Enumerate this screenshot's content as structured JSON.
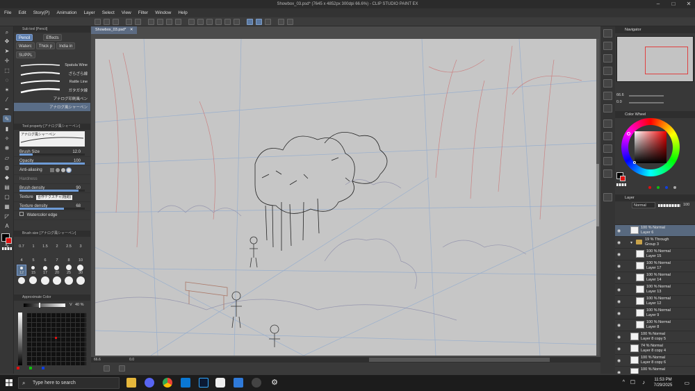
{
  "window": {
    "title": "Showbox_03.psd* (7645 x 4852px 300dpi 66.6%) - CLIP STUDIO PAINT EX"
  },
  "menu": [
    "File",
    "Edit",
    "Story(P)",
    "Animation",
    "Layer",
    "Select",
    "View",
    "Filter",
    "Window",
    "Help"
  ],
  "subtool": {
    "header": "Sub tool [Pencil]",
    "tabs": [
      "Pencil",
      "Effects",
      "Waterc",
      "Thick p",
      "India in",
      "SUPPL"
    ],
    "active_tab": "Pencil",
    "brushes": [
      "Spatula Wine",
      "ざらざら線",
      "Rattle Line",
      "ガタガタ線",
      "アナログ印刷風ペン",
      "アナログ風シャーペン"
    ],
    "active_brush": "アナログ風シャーペン"
  },
  "tool_property": {
    "header": "Tool property [アナログ風シャーペン]",
    "preview_label": "アナログ風シャーペン",
    "brush_size_label": "Brush Size",
    "brush_size": "12.0",
    "brush_size_fraction": 0.2,
    "opacity_label": "Opacity",
    "opacity": "100",
    "opacity_fraction": 1.0,
    "antialias_label": "Anti-aliasing",
    "hardness_label": "Hardness",
    "brush_density_label": "Brush density",
    "brush_density": "90",
    "brush_density_fraction": 0.9,
    "texture_label": "Texture",
    "texture_value": "合作テクスチャ(粗紙)",
    "texture_density_label": "Texture density",
    "texture_density": "68",
    "texture_density_fraction": 0.68,
    "watercolor_edge_label": "Watercolor edge"
  },
  "brush_size_panel": {
    "header": "Brush size [アナログ風シャーペン]",
    "row1": [
      "0.7",
      "1",
      "1.5",
      "2",
      "2.5",
      "3"
    ],
    "row2": [
      "4",
      "5",
      "6",
      "7",
      "8",
      "10"
    ],
    "row3": [
      "12",
      "15",
      "17",
      "20",
      "25",
      "30"
    ],
    "row4": [
      "40",
      "50",
      "60",
      "70",
      "80",
      "100"
    ],
    "selected": "12"
  },
  "approx_color": {
    "header": "Approximate Color",
    "v_label": "V",
    "v_value": "40 %",
    "v_fraction": 0.4
  },
  "canvas": {
    "tab_label": "Showbox_03.psd*",
    "zoom": "66.6",
    "status_coords": "0.0"
  },
  "navigator": {
    "header": "Navigator",
    "zoom": "66.6",
    "angle": "0.0"
  },
  "color_wheel": {
    "header": "Color Wheel",
    "main_color": "#000000",
    "sub_color": "#e01010"
  },
  "layer_panel": {
    "header": "Layer",
    "blend_mode": "Normal",
    "opacity": "100",
    "layers": [
      {
        "line1": "100 % Normal",
        "line2": "Layer 6",
        "active": true,
        "indent": 0,
        "folder": false
      },
      {
        "line1": "19 % Through",
        "line2": "Group 3",
        "active": false,
        "indent": 0,
        "folder": true
      },
      {
        "line1": "100 % Normal",
        "line2": "Layer 15",
        "active": false,
        "indent": 1,
        "folder": false
      },
      {
        "line1": "100 % Normal",
        "line2": "Layer 17",
        "active": false,
        "indent": 1,
        "folder": false
      },
      {
        "line1": "100 % Normal",
        "line2": "Layer 14",
        "active": false,
        "indent": 1,
        "folder": false
      },
      {
        "line1": "100 % Normal",
        "line2": "Layer 13",
        "active": false,
        "indent": 1,
        "folder": false
      },
      {
        "line1": "100 % Normal",
        "line2": "Layer 12",
        "active": false,
        "indent": 1,
        "folder": false
      },
      {
        "line1": "100 % Normal",
        "line2": "Layer 9",
        "active": false,
        "indent": 1,
        "folder": false
      },
      {
        "line1": "100 % Normal",
        "line2": "Layer 8",
        "active": false,
        "indent": 1,
        "folder": false
      },
      {
        "line1": "100 % Normal",
        "line2": "Layer 8 copy 5",
        "active": false,
        "indent": 0,
        "folder": false
      },
      {
        "line1": "74 % Normal",
        "line2": "Layer 8 copy 4",
        "active": false,
        "indent": 0,
        "folder": false
      },
      {
        "line1": "100 % Normal",
        "line2": "Layer 8 copy 6",
        "active": false,
        "indent": 0,
        "folder": false
      },
      {
        "line1": "100 % Normal",
        "line2": "",
        "active": false,
        "indent": 0,
        "folder": false
      }
    ]
  },
  "taskbar": {
    "search_placeholder": "Type here to search",
    "time": "11:53 PM",
    "date": "7/29/2025"
  }
}
